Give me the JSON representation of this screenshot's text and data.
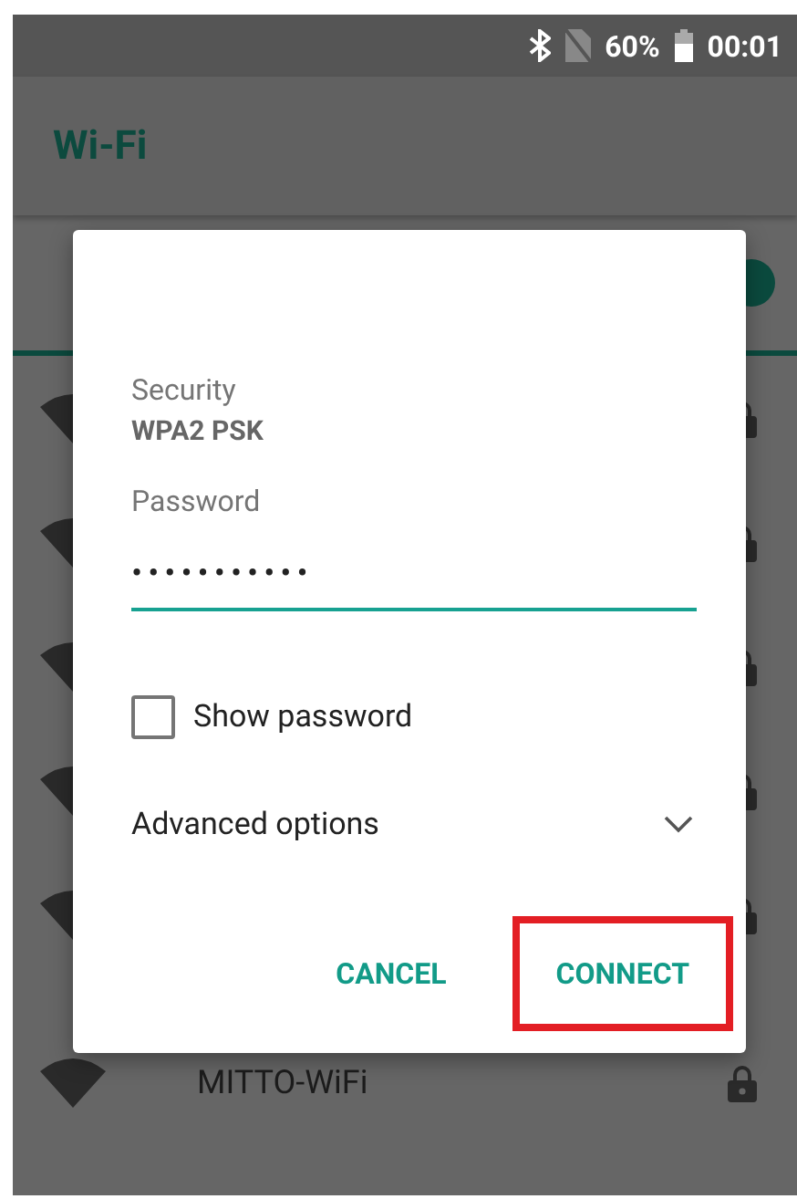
{
  "status_bar": {
    "battery": "60%",
    "time": "00:01"
  },
  "app_bar": {
    "title": "Wi-Fi"
  },
  "networks": [
    {
      "name": "MITTO-WiFi",
      "locked": true
    }
  ],
  "dialog": {
    "security_label": "Security",
    "security_value": "WPA2 PSK",
    "password_label": "Password",
    "password_value": "•••••••••••",
    "show_password": {
      "label": "Show password",
      "checked": false
    },
    "advanced_options": {
      "label": "Advanced options",
      "expanded": false
    },
    "buttons": [
      {
        "label": "CANCEL",
        "highlighted": false
      },
      {
        "label": "CONNECT",
        "highlighted": true
      }
    ]
  }
}
